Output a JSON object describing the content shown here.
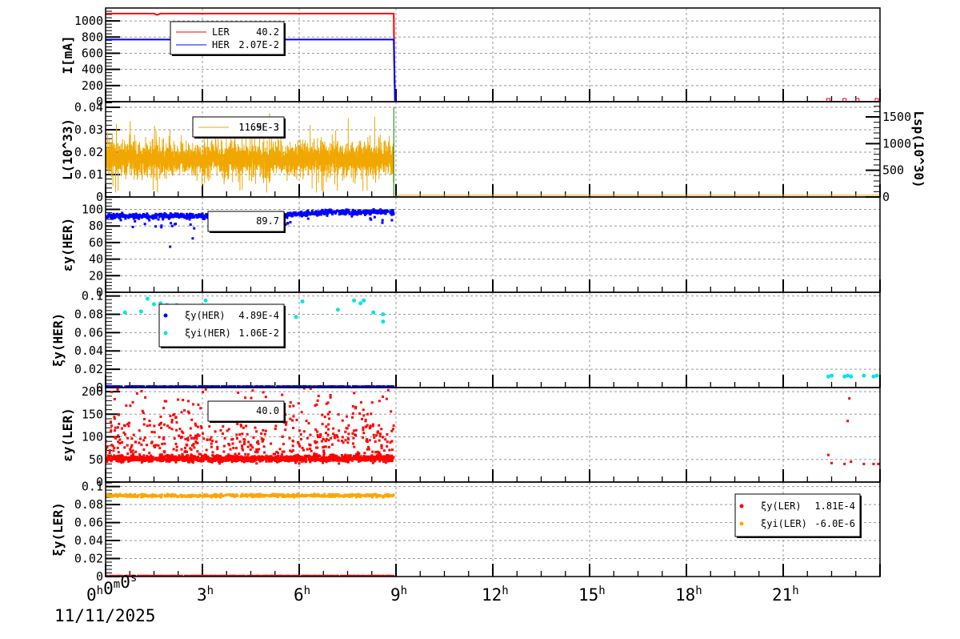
{
  "chart_data": [
    {
      "type": "line",
      "ylabel": "I[mA]",
      "ylim": [
        0,
        1160
      ],
      "yticks": [
        "0",
        "200",
        "400",
        "600",
        "800",
        "1000"
      ],
      "series": [
        {
          "name": "LER",
          "legend_value": "40.2",
          "color": "#ff0000",
          "points": [
            [
              0,
              1090
            ],
            [
              1.5,
              1090
            ],
            [
              1.6,
              1075
            ],
            [
              1.7,
              1090
            ],
            [
              8.93,
              1090
            ],
            [
              8.95,
              400
            ],
            [
              8.97,
              0
            ],
            [
              24,
              0
            ]
          ]
        },
        {
          "name": "HER",
          "legend_value": "2.07E-2",
          "color": "#0000ff",
          "points": [
            [
              0,
              770
            ],
            [
              3.0,
              770
            ],
            [
              3.05,
              755
            ],
            [
              3.1,
              770
            ],
            [
              8.93,
              770
            ],
            [
              8.95,
              380
            ],
            [
              8.97,
              0
            ],
            [
              24,
              0
            ]
          ]
        }
      ]
    },
    {
      "type": "line",
      "ylabel": "L(10^33)",
      "y2label": "Lsp(10^30)",
      "ylim": [
        0,
        0.0425
      ],
      "y2lim": [
        0,
        1785
      ],
      "yticks": [
        "0",
        "0.01",
        "0.02",
        "0.03",
        "0.04"
      ],
      "y2ticks": [
        "0",
        "500",
        "1000",
        "1500"
      ],
      "series": [
        {
          "name": "L",
          "legend_value": "1.65E-3",
          "color": "#f0a800",
          "mean": 0.017,
          "spread": 0.008,
          "x_range": [
            0,
            8.93
          ]
        },
        {
          "name": "Lsp",
          "legend_value": "11.9E-3",
          "color": "#008000",
          "mean": 0.0005,
          "x_range": [
            8.93,
            24
          ]
        }
      ]
    },
    {
      "type": "scatter",
      "ylabel": "εy(HER)",
      "ylim": [
        0,
        115
      ],
      "yticks": [
        "0",
        "20",
        "40",
        "60",
        "80",
        "100"
      ],
      "series": [
        {
          "name": "εy(HER)",
          "legend_value": "89.7",
          "color": "#0000ff",
          "mean_start": 92,
          "mean_end": 97,
          "x_range": [
            0,
            8.93
          ]
        }
      ]
    },
    {
      "type": "scatter",
      "ylabel": "ξy(HER)",
      "ylim": [
        0,
        0.104
      ],
      "yticks": [
        "0",
        "0.02",
        "0.04",
        "0.06",
        "0.08",
        "0.1"
      ],
      "series": [
        {
          "name": "ξy(HER)",
          "legend_value": "4.89E-4",
          "color": "#0000ff",
          "mean": 0.001,
          "x_range": [
            0,
            8.93
          ]
        },
        {
          "name": "ξyi(HER)",
          "legend_value": "1.06E-2",
          "color": "#00e5e5",
          "points": [
            [
              0.6,
              0.082
            ],
            [
              1.1,
              0.083
            ],
            [
              1.3,
              0.097
            ],
            [
              1.5,
              0.091
            ],
            [
              1.7,
              0.092
            ],
            [
              1.9,
              0.09
            ],
            [
              2.2,
              0.09
            ],
            [
              2.7,
              0.086
            ],
            [
              2.9,
              0.085
            ],
            [
              3.05,
              0.088
            ],
            [
              3.1,
              0.095
            ],
            [
              5.9,
              0.077
            ],
            [
              6.1,
              0.094
            ],
            [
              7.2,
              0.085
            ],
            [
              7.7,
              0.095
            ],
            [
              7.9,
              0.092
            ],
            [
              8.0,
              0.095
            ],
            [
              8.3,
              0.082
            ],
            [
              8.6,
              0.08
            ],
            [
              8.6,
              0.072
            ],
            [
              22.4,
              0.012
            ],
            [
              22.5,
              0.013
            ],
            [
              22.9,
              0.012
            ],
            [
              23.0,
              0.013
            ],
            [
              23.1,
              0.012
            ],
            [
              23.5,
              0.013
            ],
            [
              23.8,
              0.012
            ],
            [
              23.9,
              0.013
            ]
          ]
        }
      ]
    },
    {
      "type": "scatter",
      "ylabel": "εy(LER)",
      "ylim": [
        0,
        209
      ],
      "yticks": [
        "0",
        "50",
        "100",
        "150",
        "200"
      ],
      "series": [
        {
          "name": "εy(LER)",
          "legend_value": "40.0",
          "color": "#ff0000",
          "mean": 52,
          "x_range": [
            0,
            8.93
          ],
          "late_points": [
            [
              22.4,
              60
            ],
            [
              22.5,
              42
            ],
            [
              22.9,
              40
            ],
            [
              23.0,
              135
            ],
            [
              23.05,
              185
            ],
            [
              23.1,
              45
            ],
            [
              23.5,
              40
            ],
            [
              23.8,
              40
            ],
            [
              23.95,
              40
            ]
          ]
        }
      ]
    },
    {
      "type": "scatter",
      "ylabel": "ξy(LER)",
      "ylim": [
        0,
        0.105
      ],
      "yticks": [
        "0",
        "0.02",
        "0.04",
        "0.06",
        "0.08",
        "0.1"
      ],
      "series": [
        {
          "name": "ξy(LER)",
          "legend_value": "1.81E-4",
          "color": "#ff0000",
          "mean": 0.0005,
          "x_range": [
            0,
            8.93
          ]
        },
        {
          "name": "ξyi(LER)",
          "legend_value": "-6.0E-6",
          "color": "#ffa500",
          "mean": 0.09,
          "x_range": [
            0,
            8.93
          ]
        }
      ]
    }
  ],
  "x_axis": {
    "range_hours": [
      0,
      24
    ],
    "tick_labels": [
      {
        "h": "0",
        "m": "0",
        "s": "0"
      },
      {
        "h": "3"
      },
      {
        "h": "6"
      },
      {
        "h": "9"
      },
      {
        "h": "12"
      },
      {
        "h": "15"
      },
      {
        "h": "18"
      },
      {
        "h": "21"
      }
    ],
    "date": "11/11/2025"
  }
}
